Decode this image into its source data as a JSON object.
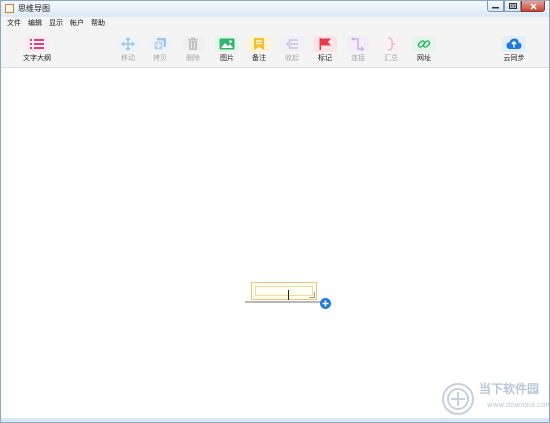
{
  "window": {
    "title": "思维导图"
  },
  "menu": [
    "文件",
    "编辑",
    "显示",
    "帐户",
    "帮助"
  ],
  "toolbar": {
    "outline": "文字大纲",
    "move": "移动",
    "copy": "拷贝",
    "delete": "删除",
    "image": "图片",
    "note": "备注",
    "collapse": "收起",
    "mark": "标记",
    "connect": "连接",
    "summary": "汇总",
    "url": "网址",
    "cloud_sync": "云同步"
  },
  "icons": {
    "outline": "list-icon",
    "move": "move-arrows-icon",
    "copy": "copy-icon",
    "delete": "trash-icon",
    "image": "image-icon",
    "note": "note-icon",
    "collapse": "collapse-icon",
    "mark": "flag-icon",
    "connect": "connect-icon",
    "summary": "brace-icon",
    "url": "link-icon",
    "cloud_sync": "cloud-upload-icon"
  },
  "colors": {
    "outline": "#d9427f",
    "move": "#5b9ee8",
    "copy": "#5b9ee8",
    "delete": "#9a9a9a",
    "image": "#34b36a",
    "note": "#f4c12b",
    "collapse": "#b497d8",
    "mark": "#e33b4e",
    "connect": "#b07ad8",
    "summary": "#e88aa8",
    "url": "#34b36a",
    "cloud_sync": "#1f7ae0",
    "add_button": "#1f7ae0",
    "node_border": "#f0c46a"
  },
  "watermark": {
    "title": "当下软件园",
    "url": "www.downxia.com"
  }
}
